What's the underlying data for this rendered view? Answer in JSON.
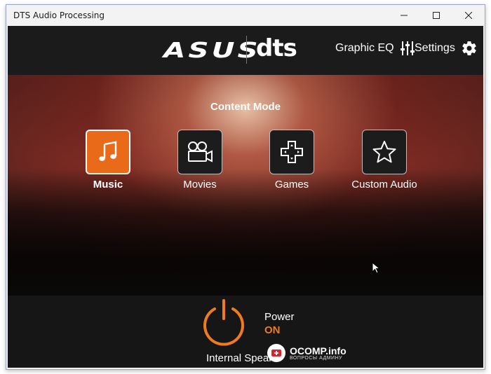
{
  "window": {
    "title": "DTS Audio Processing",
    "controls": [
      "minimize-icon",
      "maximize-icon",
      "close-icon"
    ]
  },
  "header": {
    "logos": {
      "asus": "ASUS",
      "dts": "dts"
    },
    "graphic_eq_label": "Graphic EQ",
    "graphic_eq_icon": "sliders-icon",
    "settings_label": "Settings",
    "settings_icon": "gear-icon"
  },
  "content_mode": {
    "title": "Content Mode",
    "selected": "Music",
    "modes": [
      {
        "label": "Music",
        "icon": "music-note-icon",
        "active": true
      },
      {
        "label": "Movies",
        "icon": "film-camera-icon",
        "active": false
      },
      {
        "label": "Games",
        "icon": "gamepad-icon",
        "active": false
      },
      {
        "label": "Custom Audio",
        "icon": "star-icon",
        "active": false
      }
    ]
  },
  "power": {
    "label": "Power",
    "state": "ON",
    "device": "Internal Speake"
  },
  "watermark": {
    "text": "OCOMP.info",
    "subtext": "ВОПРОСЫ АДМИНУ"
  },
  "colors": {
    "accent": "#f07b1c",
    "active_tile": "#e96b1a",
    "app_background": "#161616"
  }
}
